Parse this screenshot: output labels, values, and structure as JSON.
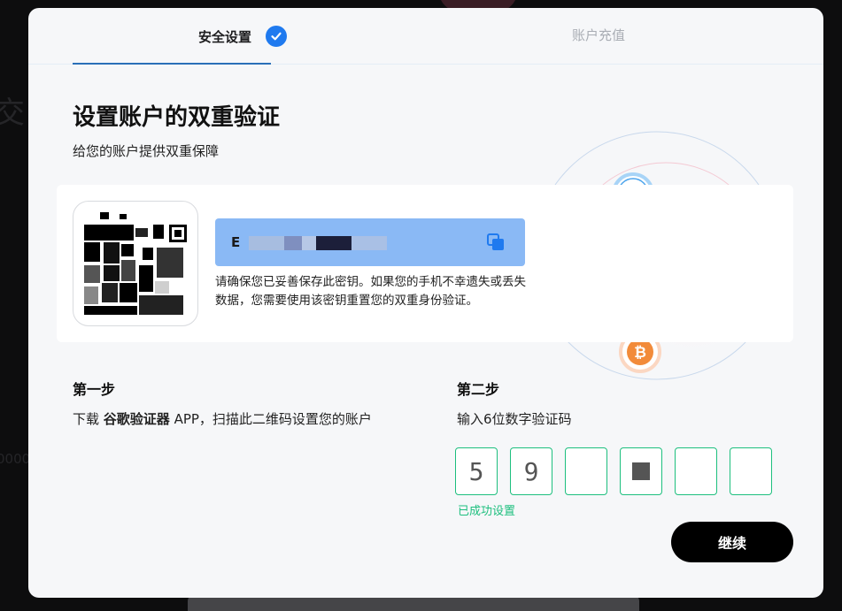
{
  "background": {
    "glyph": "交",
    "number_fragment": "0000"
  },
  "tabs": [
    {
      "label": "安全设置",
      "completed": true
    },
    {
      "label": "账户充值",
      "completed": false
    }
  ],
  "header": {
    "title": "设置账户的双重验证",
    "subtitle": "给您的账户提供双重保障"
  },
  "secret_key": {
    "visible_prefix": "E",
    "warning": "请确保您已妥善保存此密钥。如果您的手机不幸遗失或丢失数据，您需要使用该密钥重置您的双重身份验证。"
  },
  "step1": {
    "title": "第一步",
    "desc_prefix": "下载 ",
    "app_name": "谷歌验证器",
    "desc_suffix": " APP，扫描此二维码设置您的账户"
  },
  "step2": {
    "title": "第二步",
    "desc": "输入6位数字验证码",
    "code_digits": [
      "5",
      "9",
      "",
      "",
      "",
      ""
    ],
    "success_text": "已成功设置"
  },
  "continue_label": "继续",
  "colors": {
    "accent_blue": "#1f7aef",
    "success_green": "#1dbf7e",
    "secret_bg": "#8ab9f5",
    "primary_button": "#000000"
  },
  "icons": [
    "check-icon",
    "copy-icon",
    "qr-code",
    "avalanche-icon",
    "ethereum-icon",
    "bitcoin-icon",
    "mascot-illustration"
  ]
}
